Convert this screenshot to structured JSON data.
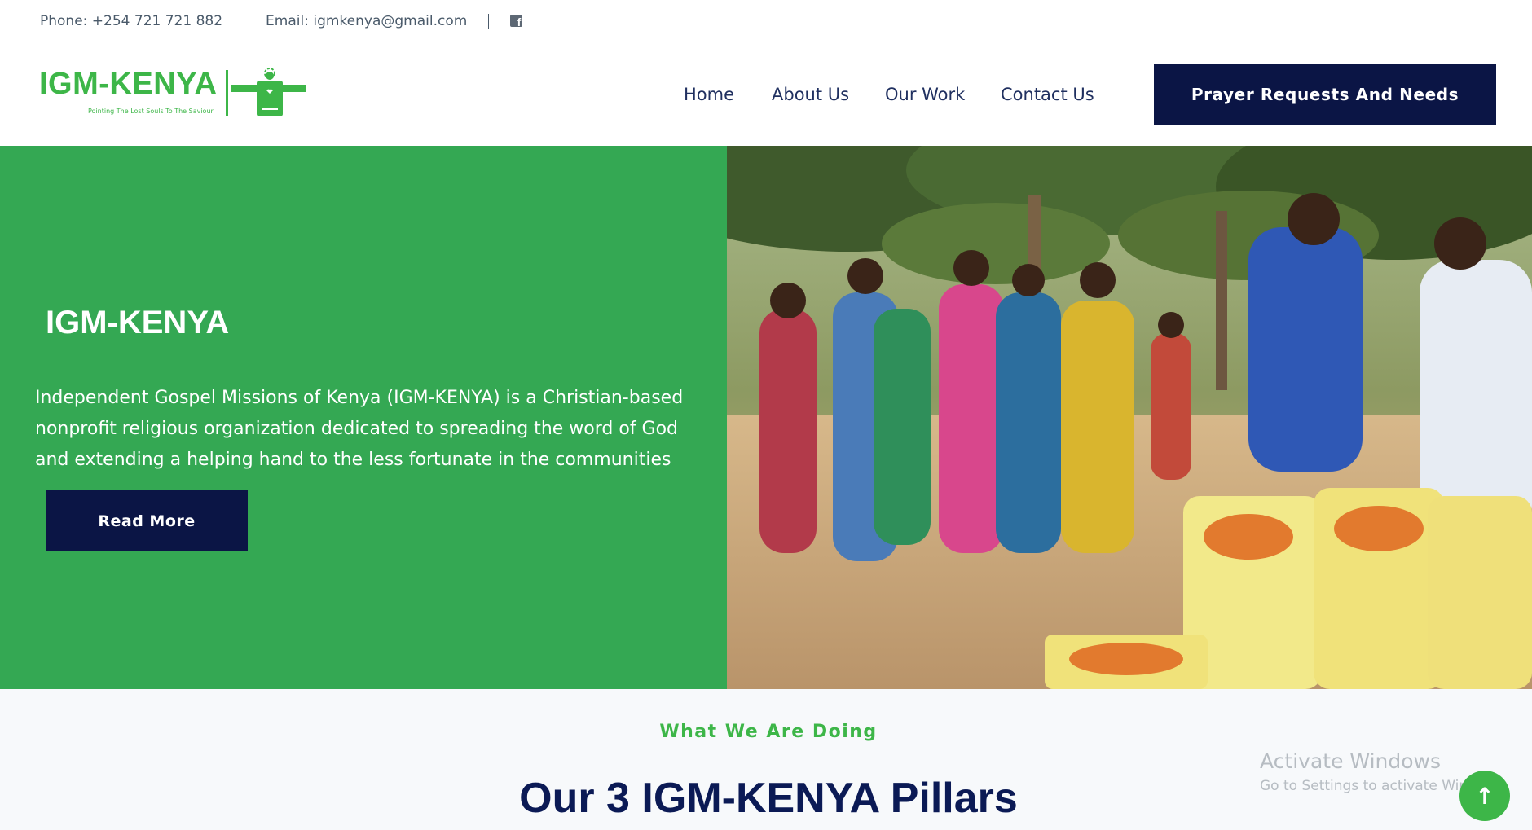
{
  "topbar": {
    "phone": "Phone: +254 721 721 882",
    "email": "Email: igmkenya@gmail.com",
    "social_icon": "facebook-icon"
  },
  "header": {
    "logo_text": "IGM-KENYA",
    "logo_tagline": "Pointing The Lost Souls To The Saviour",
    "nav": [
      "Home",
      "About Us",
      "Our Work",
      "Contact Us"
    ],
    "cta_label": "Prayer Requests And Needs"
  },
  "hero": {
    "title": "IGM-KENYA",
    "description": "Independent Gospel Missions of Kenya (IGM-KENYA) is a Christian-based nonprofit religious organization dedicated to spreading the word of God and extending a helping hand to the less fortunate in the communities",
    "button_label": "Read More",
    "photo_icon": "community-food-distribution-photo"
  },
  "section": {
    "kicker": "What We Are Doing",
    "title": "Our 3 IGM-KENYA Pillars"
  },
  "overlay": {
    "activate_title": "Activate Windows",
    "activate_sub": "Go to Settings to activate Windows.",
    "scroll_icon": "arrow-up-icon"
  },
  "colors": {
    "green": "#34a853",
    "brand_green": "#3db648",
    "navy": "#0b1545"
  }
}
